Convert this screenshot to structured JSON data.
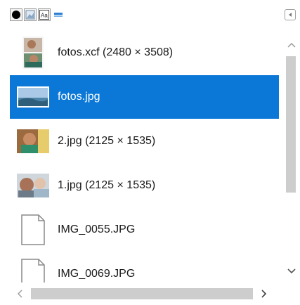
{
  "tabs": [
    {
      "name": "tab-brushes",
      "icon": "brush-circle-icon"
    },
    {
      "name": "tab-patterns",
      "icon": "pattern-icon"
    },
    {
      "name": "tab-fonts",
      "icon": "font-icon"
    },
    {
      "name": "tab-images",
      "icon": "images-icon"
    }
  ],
  "tab_menu_icon": "tab-menu-icon",
  "images": [
    {
      "label": "fotos.xcf (2480 × 3508)",
      "icon": "xcf-thumbnail-icon",
      "selected": false
    },
    {
      "label": "fotos.jpg",
      "icon": "landscape-thumbnail-icon",
      "selected": true
    },
    {
      "label": "2.jpg (2125 × 1535)",
      "icon": "photo-thumbnail-icon",
      "selected": false
    },
    {
      "label": "1.jpg (2125 × 1535)",
      "icon": "photo-thumbnail-icon",
      "selected": false
    },
    {
      "label": "IMG_0055.JPG",
      "icon": "blank-file-icon",
      "selected": false
    },
    {
      "label": "IMG_0069.JPG",
      "icon": "blank-file-icon",
      "selected": false
    }
  ],
  "colors": {
    "selection": "#0b78d7",
    "scroll_thumb": "#cdcdcd",
    "text": "#1a1a1a"
  }
}
